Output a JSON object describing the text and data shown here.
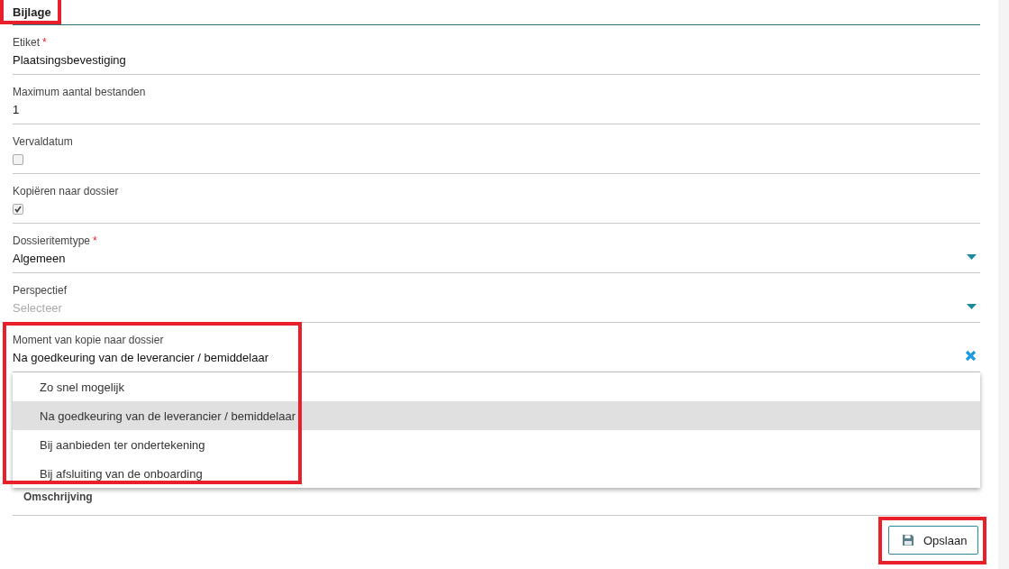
{
  "section": {
    "title": "Bijlage",
    "highlighted": true
  },
  "fields": [
    {
      "kind": "text",
      "label": "Etiket",
      "required_mark": "*",
      "value": "Plaatsingsbevestiging"
    },
    {
      "kind": "text",
      "label": "Maximum aantal bestanden",
      "value": "1"
    },
    {
      "kind": "checkbox",
      "label": "Vervaldatum",
      "checked": false
    },
    {
      "kind": "checkbox",
      "label": "Kopiëren naar dossier",
      "checked": true
    },
    {
      "kind": "select",
      "label": "Dossieritemtype",
      "required_mark": "*",
      "value": "Algemeen"
    },
    {
      "kind": "select",
      "label": "Perspectief",
      "placeholder": "Selecteer"
    },
    {
      "kind": "clearable",
      "label": "Moment van kopie naar dossier",
      "value": "Na goedkeuring van de leverancier / bemiddelaar",
      "highlighted": true,
      "options": [
        {
          "label": "Zo snel mogelijk",
          "selected": false
        },
        {
          "label": "Na goedkeuring van de leverancier / bemiddelaar",
          "selected": true
        },
        {
          "label": "Bij aanbieden ter ondertekening",
          "selected": false
        },
        {
          "label": "Bij afsluiting van de onboarding",
          "selected": false
        }
      ]
    },
    {
      "kind": "section",
      "label": "Omschrijving"
    }
  ],
  "save_button": {
    "label": "Opslaan",
    "highlighted": true
  }
}
